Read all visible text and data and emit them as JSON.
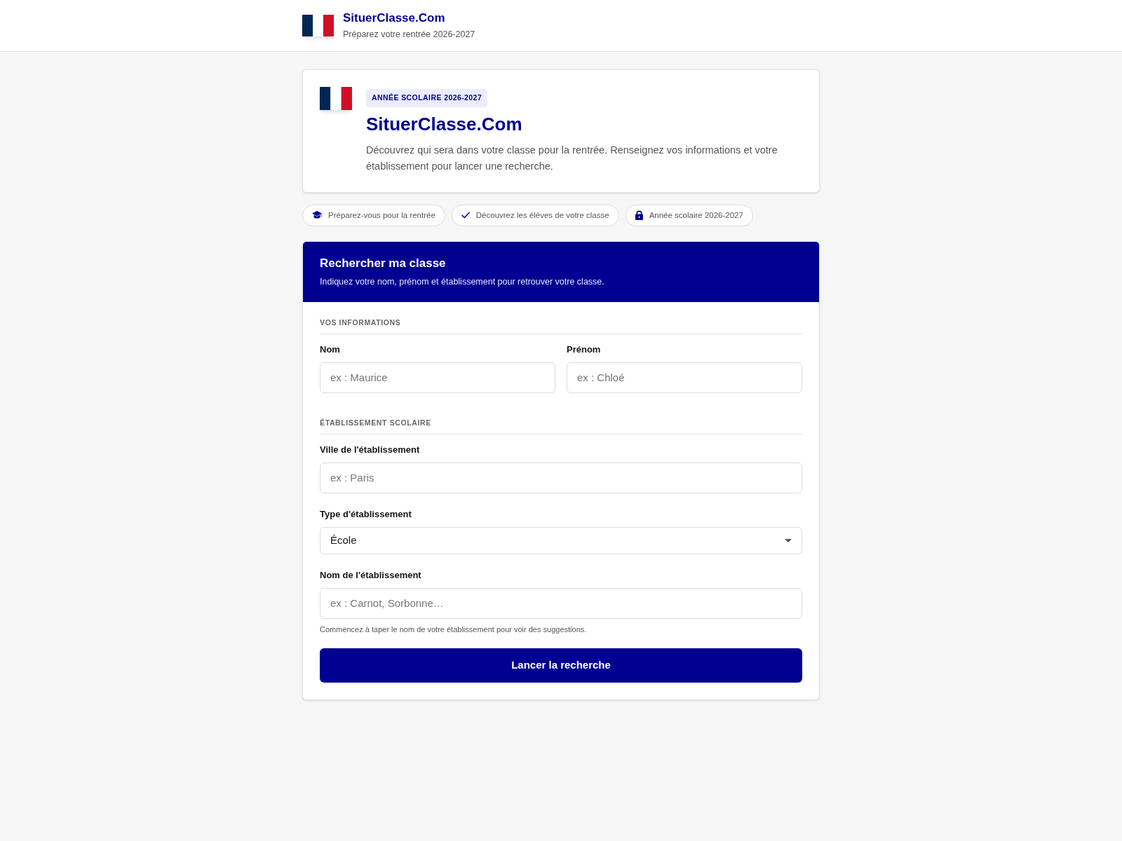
{
  "header": {
    "title": "SituerClasse.Com",
    "subtitle": "Préparez votre rentrée 2026-2027"
  },
  "hero": {
    "badge": "ANNÉE SCOLAIRE 2026-2027",
    "title": "SituerClasse.Com",
    "description": "Découvrez qui sera dans votre classe pour la rentrée. Renseignez vos informations et votre établissement pour lancer une recherche."
  },
  "chips": [
    {
      "kind": "graduation",
      "label": "Préparez-vous pour la rentrée"
    },
    {
      "kind": "check",
      "label": "Découvrez les élèves de votre classe"
    },
    {
      "kind": "lock",
      "label": "Année scolaire 2026-2027"
    }
  ],
  "form": {
    "title": "Rechercher ma classe",
    "subtitle": "Indiquez votre nom, prénom et établissement pour retrouver votre classe.",
    "sections": [
      {
        "kind": "pair",
        "heading": "VOS INFORMATIONS",
        "fields": [
          {
            "kind": "text",
            "label": "Nom",
            "placeholder": "ex : Maurice"
          },
          {
            "kind": "text",
            "label": "Prénom",
            "placeholder": "ex : Chloé"
          }
        ]
      },
      {
        "kind": "stack",
        "heading": "ÉTABLISSEMENT SCOLAIRE",
        "fields": [
          {
            "kind": "text",
            "label": "Ville de l'établissement",
            "placeholder": "ex : Paris"
          },
          {
            "kind": "select",
            "label": "Type d'établissement",
            "value": "École"
          },
          {
            "kind": "text",
            "label": "Nom de l'établissement",
            "placeholder": "ex : Carnot, Sorbonne…",
            "hint": "Commencez à taper le nom de votre établissement pour voir des suggestions."
          }
        ]
      }
    ],
    "submit": "Lancer la recherche"
  }
}
